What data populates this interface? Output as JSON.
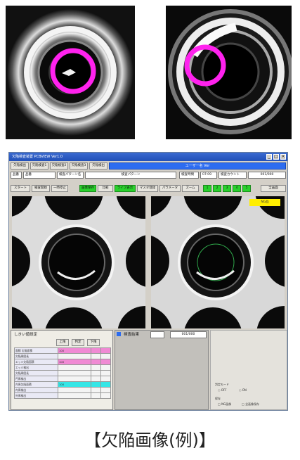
{
  "caption": "【欠陥画像(例)】",
  "window": {
    "title": "欠陥検査装置 PCBVIEW Ver1.0",
    "header_bar": "ユーザー名 Ver",
    "row1": {
      "a": "欠陥検出",
      "b": "欠陥検査1",
      "c": "欠陥検査2",
      "d": "欠陥検査3",
      "e": "欠陥検出"
    },
    "row2": {
      "lot_label": "品番",
      "lot_value": "品番",
      "model_label": "検査パターン名",
      "model_value": "検査パターン",
      "time_label": "検査時間",
      "time_value": "07:09",
      "count_label": "検査カウント",
      "count_value": "001/000"
    },
    "row3": {
      "b1": "スタート",
      "b2": "検査開始",
      "b3": "一時停止",
      "g1": "画像保存",
      "g2": "比較",
      "g3": "ライブ表示",
      "b4": "マスタ登録",
      "b5": "パラメータ",
      "b6": "ズーム",
      "g4": "1",
      "g5": "2",
      "g6": "3",
      "g7": "4",
      "g8": "5",
      "b7": "全画面"
    },
    "camera_tag": "NG品",
    "settings": {
      "title": "しきい値設定",
      "h1": "上限",
      "h2": "判定",
      "h3": "下限",
      "rows": [
        {
          "label": "面積 欠陥面積",
          "v": "100",
          "style": "pink"
        },
        {
          "label": "欠陥周囲長",
          "v": "",
          "style": "plain"
        },
        {
          "label": "エッジ欠陥面積",
          "v": "100",
          "style": "pink"
        },
        {
          "label": "エッジ検出",
          "v": "",
          "style": "plain"
        },
        {
          "label": "欠陥周囲長",
          "v": "",
          "style": "plain"
        },
        {
          "label": "円周検出",
          "v": "",
          "style": "plain"
        },
        {
          "label": "内周欠陥面積",
          "v": "100",
          "style": "cyan"
        },
        {
          "label": "内周検出",
          "v": "",
          "style": "plain"
        },
        {
          "label": "外周検出",
          "v": "",
          "style": "plain"
        }
      ]
    },
    "info": {
      "title": "検査結果",
      "value": "001/000"
    },
    "options": {
      "group1": "判定モード",
      "opt1": "OFF",
      "opt2": "ON",
      "group2": "保存",
      "opt3": "NG画像",
      "opt4": "全画像保存"
    }
  }
}
